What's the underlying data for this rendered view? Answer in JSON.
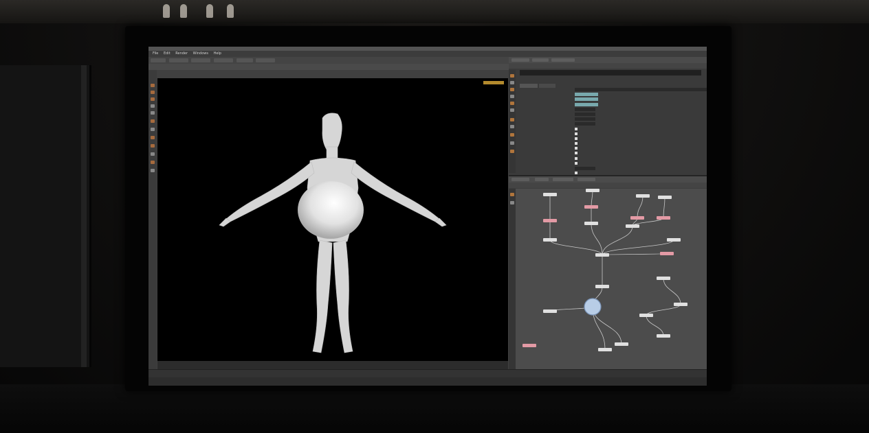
{
  "app": {
    "menu": [
      "File",
      "Edit",
      "Render",
      "Windows",
      "Help"
    ]
  },
  "viewport": {
    "label": "",
    "path": "",
    "frame_start": "",
    "frame_end": "",
    "frame_current": ""
  },
  "status": {
    "text": ""
  },
  "parameters": {
    "path": "",
    "node": "",
    "tabs": [
      "",
      ""
    ],
    "rows": [
      {
        "label": "",
        "kind": "field",
        "value": ""
      },
      {
        "label": "",
        "kind": "field",
        "value": ""
      },
      {
        "label": "",
        "kind": "field",
        "value": ""
      },
      {
        "label": "",
        "kind": "field",
        "value": ""
      },
      {
        "label": "",
        "kind": "field",
        "value": ""
      },
      {
        "label": "",
        "kind": "field",
        "value": ""
      },
      {
        "label": "",
        "kind": "field",
        "value": ""
      },
      {
        "label": "",
        "kind": "field",
        "value": ""
      },
      {
        "label": "",
        "kind": "check",
        "value": ""
      },
      {
        "label": "",
        "kind": "check",
        "value": ""
      },
      {
        "label": "",
        "kind": "check",
        "value": ""
      },
      {
        "label": "",
        "kind": "check",
        "value": ""
      },
      {
        "label": "",
        "kind": "check",
        "value": ""
      },
      {
        "label": "",
        "kind": "check",
        "value": ""
      },
      {
        "label": "",
        "kind": "check",
        "value": ""
      },
      {
        "label": "",
        "kind": "check",
        "value": ""
      },
      {
        "label": "",
        "kind": "field",
        "value": ""
      },
      {
        "label": "",
        "kind": "check",
        "value": ""
      },
      {
        "label": "",
        "kind": "check",
        "value": ""
      }
    ]
  },
  "network": {
    "path": "",
    "nodes": [
      {
        "label": "",
        "color": "#e0e0e0"
      },
      {
        "label": "",
        "color": "#e0e0e0"
      },
      {
        "label": "",
        "color": "#e0e0e0"
      },
      {
        "label": "",
        "color": "#e0e0e0"
      },
      {
        "label": "",
        "color": "#e39aa5"
      },
      {
        "label": "",
        "color": "#e39aa5"
      },
      {
        "label": "",
        "color": "#e39aa5"
      },
      {
        "label": "",
        "color": "#e39aa5"
      },
      {
        "label": "",
        "color": "#e0e0e0"
      },
      {
        "label": "",
        "color": "#e0e0e0"
      },
      {
        "label": "",
        "color": "#e0e0e0"
      },
      {
        "label": "",
        "color": "#e0e0e0"
      },
      {
        "label": "",
        "color": "#e0e0e0"
      },
      {
        "label": "",
        "color": "#e39aa5"
      },
      {
        "label": "",
        "color": "#e0e0e0"
      },
      {
        "label": "",
        "color": "#e0e0e0"
      },
      {
        "label": "",
        "color": "#e0e0e0"
      },
      {
        "label": "",
        "color": "#e0e0e0"
      },
      {
        "label": "",
        "color": "#e0e0e0"
      },
      {
        "label": "",
        "color": "#e0e0e0"
      },
      {
        "label": "",
        "color": "#e39aa5"
      },
      {
        "label": "",
        "color": "#e0e0e0"
      },
      {
        "label": "",
        "color": "#e0e0e0"
      }
    ],
    "selected": {
      "label": "",
      "color": "#b8cde6"
    }
  },
  "colors": {
    "accent_orange": "#b0753c",
    "param_teal": "#78a9ad",
    "node_pink": "#e39aa5",
    "node_white": "#e0e0e0",
    "viewport_bg": "#000000",
    "figure": "#d8d8d8"
  }
}
